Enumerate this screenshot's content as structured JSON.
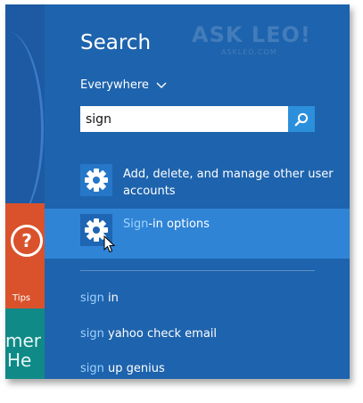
{
  "start_tiles": {
    "tips_label": "Tips",
    "tips_glyph": "?",
    "weather_line1": "mer",
    "weather_line2": "He"
  },
  "search": {
    "title": "Search",
    "scope": "Everywhere",
    "query": "sign",
    "watermark": "ASK LEO!",
    "watermark_sub": "ASKLEO.COM"
  },
  "results": [
    {
      "icon": "gear-icon",
      "match": "",
      "rest": "Add, delete, and manage other user accounts",
      "selected": false
    },
    {
      "icon": "gear-icon",
      "match": "Sign",
      "rest": "-in options",
      "selected": true
    }
  ],
  "suggestions": [
    {
      "match": "sign",
      "rest": " in"
    },
    {
      "match": "sign",
      "rest": " yahoo check email"
    },
    {
      "match": "sign",
      "rest": " up genius"
    }
  ],
  "colors": {
    "panel": "#1e63ad",
    "selected": "#2f84d6",
    "search_button": "#2b8fdc",
    "highlight": "#9fd2ff",
    "tips_tile": "#d9522c",
    "weather_tile": "#0f8a87"
  }
}
